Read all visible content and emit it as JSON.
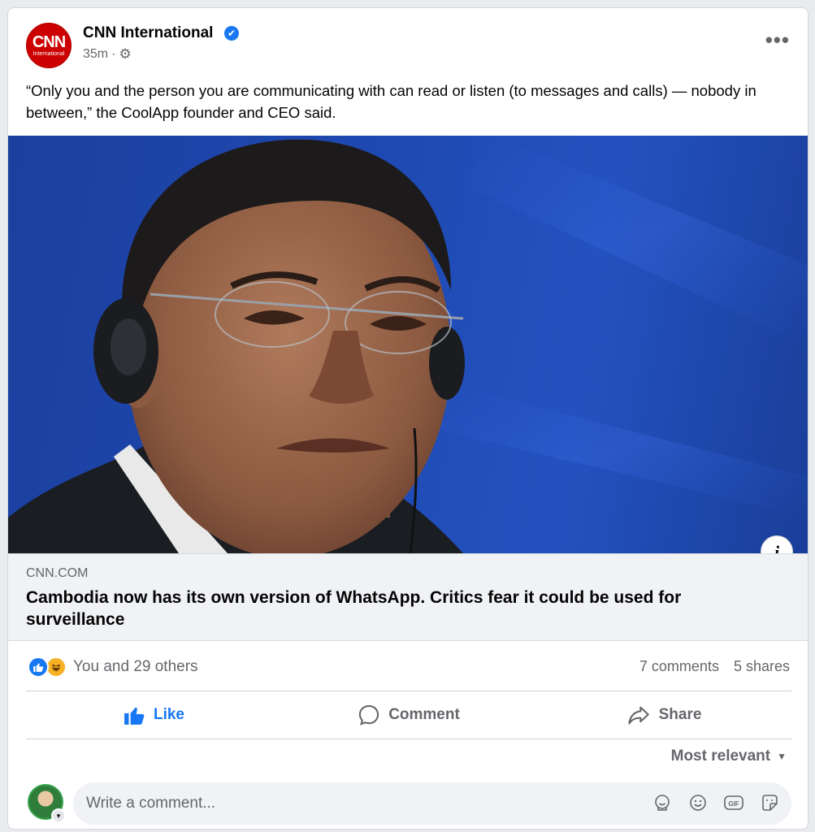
{
  "post": {
    "page_name": "CNN International",
    "avatar": {
      "main": "CNN",
      "sub": "International"
    },
    "verified_icon": "✔",
    "time": "35m",
    "separator": "·",
    "audience_icon": "⚙",
    "more_icon": "•••",
    "text": "“Only you and the person you are communicating with can read or listen (to messages and calls) — nobody in between,” the CoolApp founder and CEO said."
  },
  "link": {
    "domain": "CNN.COM",
    "title": "Cambodia now has its own version of WhatsApp. Critics fear it could be used for surveillance",
    "info_icon": "i"
  },
  "engagement": {
    "reaction_text": "You and 29 others",
    "comments": "7 comments",
    "shares": "5 shares"
  },
  "actions": {
    "like": "Like",
    "comment": "Comment",
    "share": "Share"
  },
  "comments": {
    "sort_label": "Most relevant",
    "sort_icon": "▼",
    "placeholder": "Write a comment..."
  },
  "colors": {
    "brand_blue": "#1877f2",
    "cnn_red": "#cc0000",
    "muted_text": "#65676b",
    "photo_background": "#1e48b0"
  }
}
